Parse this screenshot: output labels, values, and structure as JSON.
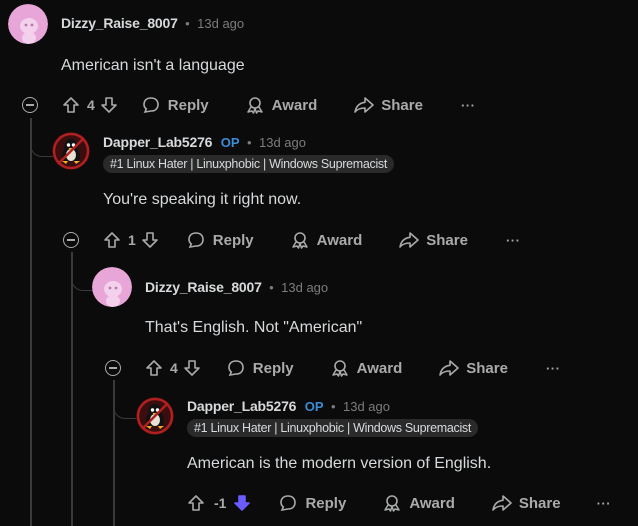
{
  "comments": [
    {
      "username": "Dizzy_Raise_8007",
      "time": "13d ago",
      "body": "American isn't a language",
      "votes": "4",
      "reply": "Reply",
      "award": "Award",
      "share": "Share",
      "more": "···"
    },
    {
      "username": "Dapper_Lab5276",
      "op": "OP",
      "time": "13d ago",
      "flair": "#1 Linux Hater | Linuxphobic | Windows Supremacist",
      "body": "You're speaking it right now.",
      "votes": "1",
      "reply": "Reply",
      "award": "Award",
      "share": "Share",
      "more": "···"
    },
    {
      "username": "Dizzy_Raise_8007",
      "time": "13d ago",
      "body": "That's English. Not \"American\"",
      "votes": "4",
      "reply": "Reply",
      "award": "Award",
      "share": "Share",
      "more": "···"
    },
    {
      "username": "Dapper_Lab5276",
      "op": "OP",
      "time": "13d ago",
      "flair": "#1 Linux Hater | Linuxphobic | Windows Supremacist",
      "body": "American is the modern version of English.",
      "votes": "-1",
      "reply": "Reply",
      "award": "Award",
      "share": "Share",
      "more": "···"
    }
  ],
  "separator": "•",
  "icons": {
    "upvote": "arrow-up-outline-icon",
    "downvote": "arrow-down-outline-icon",
    "downvote_active": "arrow-down-filled-icon",
    "reply": "speech-bubble-icon",
    "award": "award-ribbon-icon",
    "share": "share-arrow-icon",
    "collapse": "minus-circle-icon",
    "avatar_default": "snoo-avatar-icon",
    "avatar_op": "tux-penguin-avatar-icon"
  },
  "colors": {
    "background": "#0b0b0b",
    "op_badge": "#3e8bd6",
    "downvote_active": "#6a5cff",
    "avatar_pink": "#e8a5d8"
  }
}
